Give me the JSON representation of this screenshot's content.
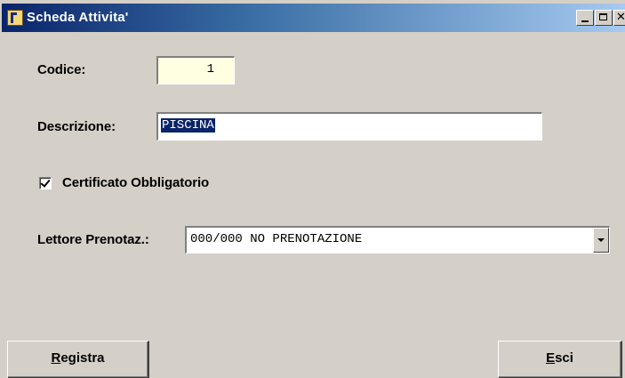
{
  "window": {
    "title": "Scheda Attivita'",
    "icon": "app-icon",
    "controls": [
      "minimize-icon",
      "maximize-icon",
      "close-icon"
    ]
  },
  "form": {
    "codice_label": "Codice:",
    "codice_value": "1",
    "descrizione_label": "Descrizione:",
    "descrizione_value": "PISCINA",
    "certificato_label": "Certificato Obbligatorio",
    "certificato_checked": true,
    "lettore_label": "Lettore Prenotaz.:",
    "lettore_value": "000/000 NO PRENOTAZIONE"
  },
  "buttons": {
    "registra_mnemonic": "R",
    "registra_rest": "egistra",
    "esci_mnemonic": "E",
    "esci_rest": "sci"
  },
  "colors": {
    "face": "#d4d0c8",
    "title_start": "#0a246a",
    "title_end": "#a6caf0",
    "codice_bg": "#ffffe1",
    "selection": "#0a246a"
  }
}
